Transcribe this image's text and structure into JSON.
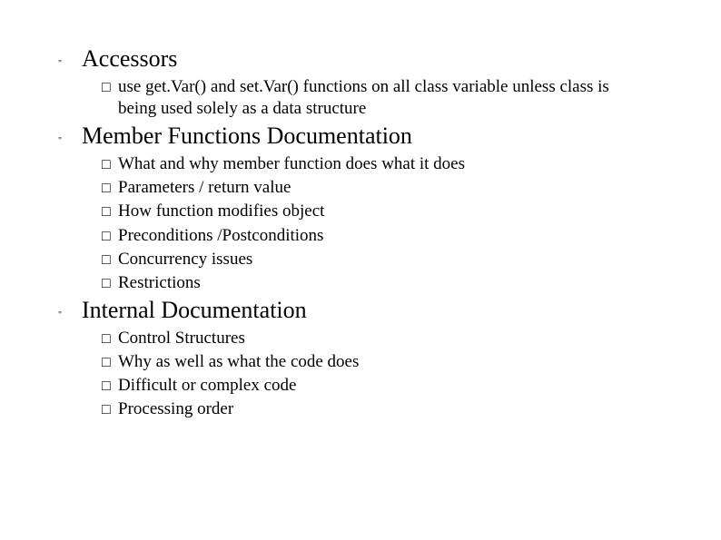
{
  "sections": [
    {
      "title": "Accessors",
      "items": [
        "use get.Var() and set.Var() functions on all class variable unless class is being used solely as a data structure"
      ]
    },
    {
      "title": "Member Functions Documentation",
      "items": [
        "What and why member function does what it does",
        "Parameters / return value",
        "How function modifies object",
        "Preconditions /Postconditions",
        "Concurrency issues",
        "Restrictions"
      ]
    },
    {
      "title": "Internal Documentation",
      "items": [
        "Control Structures",
        "Why as well as what the code does",
        "Difficult or complex code",
        "Processing order"
      ]
    }
  ],
  "bulletMarker": "\"",
  "checkboxGlyph": "□"
}
